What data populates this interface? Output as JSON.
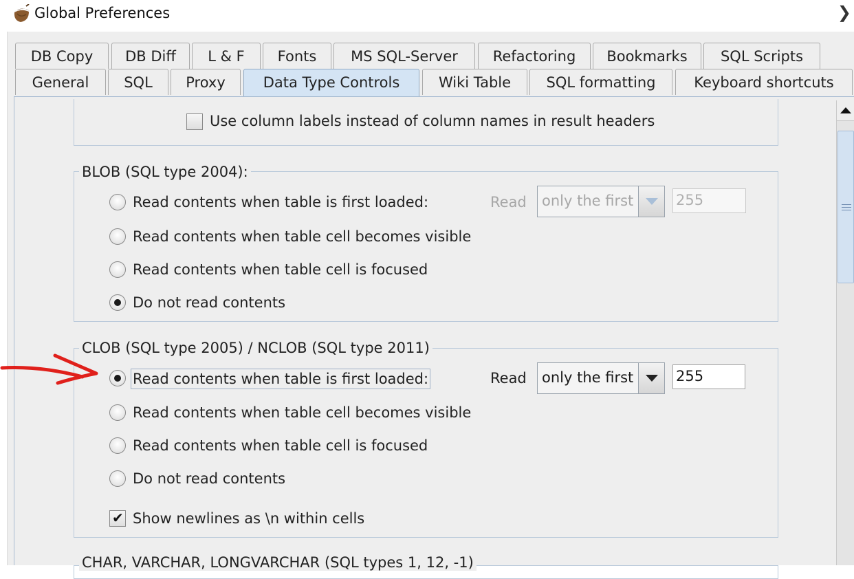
{
  "window": {
    "title": "Global Preferences"
  },
  "tabs_row1": [
    "DB Copy",
    "DB Diff",
    "L & F",
    "Fonts",
    "MS SQL-Server",
    "Refactoring",
    "Bookmarks",
    "SQL Scripts"
  ],
  "tabs_row2": [
    "General",
    "SQL",
    "Proxy",
    "Data Type Controls",
    "Wiki Table",
    "SQL formatting",
    "Keyboard shortcuts"
  ],
  "active_tab": "Data Type Controls",
  "top_checkbox": {
    "label": "Use column labels instead of column names in result headers",
    "checked": false
  },
  "blob": {
    "title": "BLOB   (SQL type 2004):",
    "options": [
      "Read contents when table is first loaded:",
      "Read contents when table cell becomes visible",
      "Read contents when table cell is focused",
      "Do not read contents"
    ],
    "selected_index": 3,
    "read_label": "Read",
    "read_mode": "only the first",
    "read_limit": "255",
    "read_controls_enabled": false
  },
  "clob": {
    "title": "CLOB   (SQL type 2005) / NCLOB   (SQL type 2011)",
    "options": [
      "Read contents when table is first loaded:",
      "Read contents when table cell becomes visible",
      "Read contents when table cell is focused",
      "Do not read contents"
    ],
    "selected_index": 0,
    "read_label": "Read",
    "read_mode": "only the first",
    "read_limit": "255",
    "read_controls_enabled": true,
    "newline_checkbox": {
      "label": "Show newlines as \\n within cells",
      "checked": true
    }
  },
  "next_group": {
    "title": "CHAR, VARCHAR, LONGVARCHAR   (SQL types 1, 12, -1)"
  },
  "colors": {
    "annotation_arrow": "#e0201b",
    "active_tab": "#d4e4f4",
    "group_border": "#b9c9da"
  }
}
